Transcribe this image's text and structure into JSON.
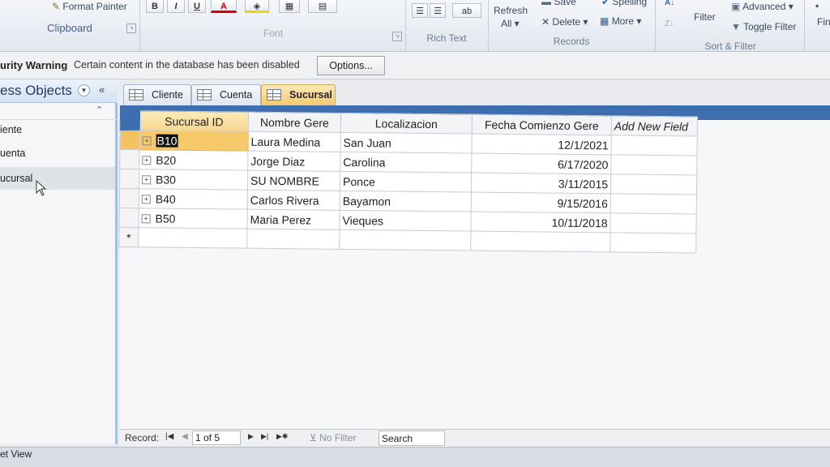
{
  "ribbon": {
    "clipboard": {
      "format_painter": "Format Painter",
      "label": "Clipboard"
    },
    "font": {
      "bold": "B",
      "italic": "I",
      "underline": "U",
      "font_color": "A",
      "label": "Font"
    },
    "rich_text": {
      "label": "Rich Text"
    },
    "records": {
      "refresh_line1": "Refresh",
      "refresh_line2": "All ▾",
      "save": "Save",
      "delete": "Delete ▾",
      "spelling": "Spelling",
      "more": "More ▾",
      "label": "Records"
    },
    "sort_filter": {
      "filter": "Filter",
      "advanced": "Advanced ▾",
      "toggle_filter": "Toggle Filter",
      "label": "Sort & Filter"
    },
    "find": {
      "label": "Fin"
    }
  },
  "security_bar": {
    "title": "urity Warning",
    "message": "Certain content in the database has been disabled",
    "options_button": "Options..."
  },
  "nav_pane": {
    "title": "ess Objects",
    "items": [
      "iente",
      "uenta",
      "ucursal"
    ]
  },
  "tabs": [
    {
      "label": "Cliente"
    },
    {
      "label": "Cuenta"
    },
    {
      "label": "Sucursal"
    }
  ],
  "datasheet": {
    "columns": [
      "Sucursal ID",
      "Nombre Gere",
      "Localizacion",
      "Fecha Comienzo Gere",
      "Add New Field"
    ],
    "rows": [
      [
        "B10",
        "Laura Medina",
        "San Juan",
        "12/1/2021"
      ],
      [
        "B20",
        "Jorge Diaz",
        "Carolina",
        "6/17/2020"
      ],
      [
        "B30",
        "SU NOMBRE",
        "Ponce",
        "3/11/2015"
      ],
      [
        "B40",
        "Carlos Rivera",
        "Bayamon",
        "9/15/2016"
      ],
      [
        "B50",
        "Maria Perez",
        "Vieques",
        "10/11/2018"
      ]
    ],
    "new_row_marker": "*"
  },
  "record_nav": {
    "label": "Record:",
    "position": "1 of 5",
    "no_filter": "No Filter",
    "search": "Search"
  },
  "status_bar": {
    "text": "et View"
  },
  "colors": {
    "accent": "#3d6eb0",
    "tab_active": "#f5c96c",
    "selected_cell": "#f6c96a"
  }
}
